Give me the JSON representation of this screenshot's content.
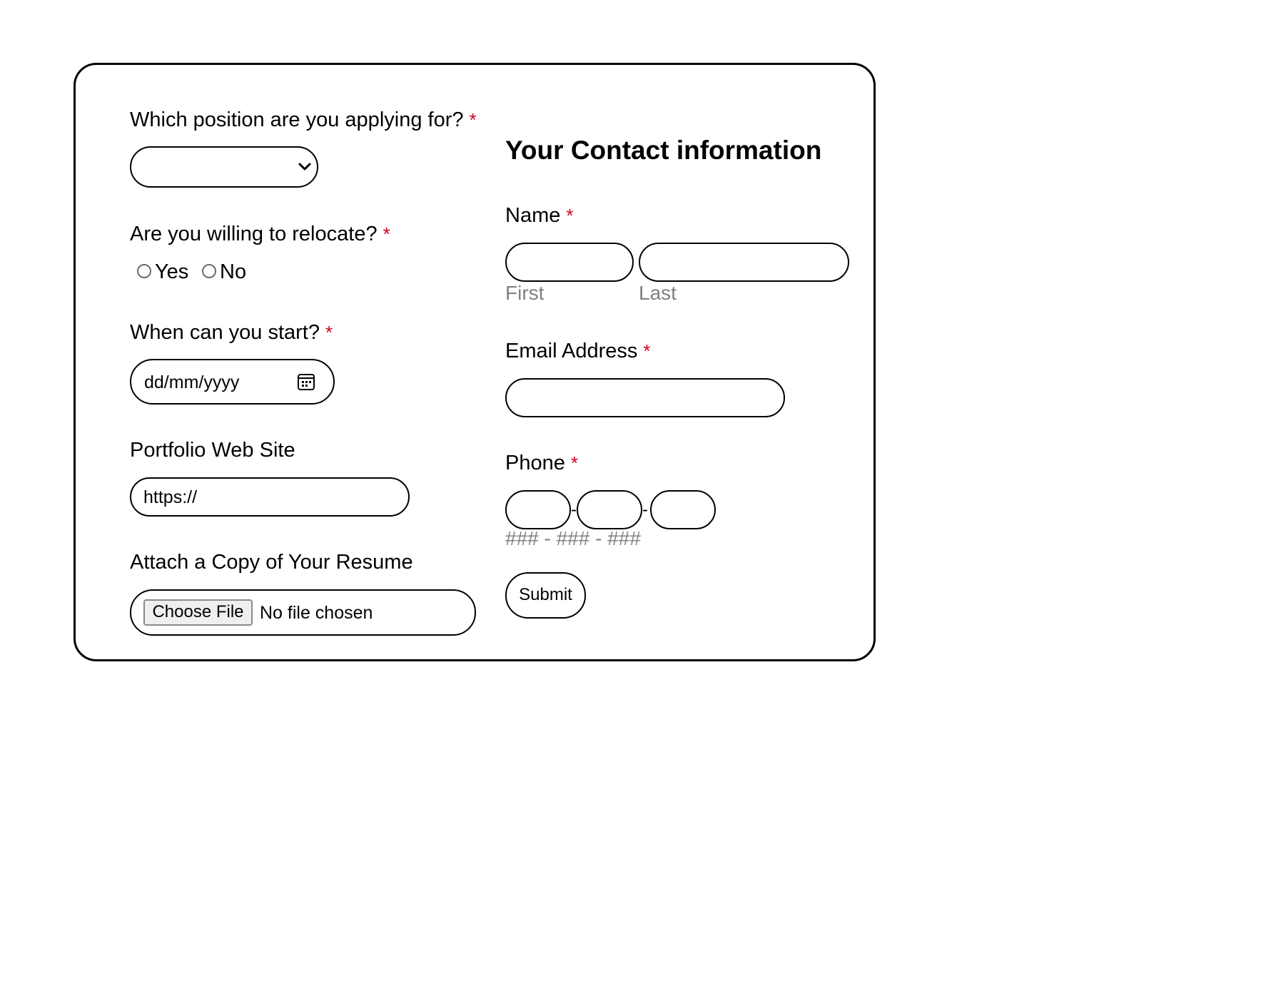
{
  "form": {
    "required_mark": "*",
    "position": {
      "label": "Which position are you applying for?",
      "selected_value": "",
      "icon": "chevron-down-icon"
    },
    "relocate": {
      "label": "Are you willing to relocate?",
      "options": [
        "Yes",
        "No"
      ]
    },
    "start_date": {
      "label": "When can you start?",
      "placeholder": "dd/mm/yyyy",
      "icon": "calendar-icon"
    },
    "portfolio": {
      "label": "Portfolio Web Site",
      "value": "https://"
    },
    "resume": {
      "label": "Attach a Copy of Your Resume",
      "button_label": "Choose File",
      "status_text": "No file chosen"
    },
    "contact": {
      "heading": "Your Contact information",
      "name": {
        "label": "Name",
        "first_sublabel": "First",
        "last_sublabel": "Last"
      },
      "email": {
        "label": "Email Address"
      },
      "phone": {
        "label": "Phone",
        "separator": "-",
        "format_hint": "### - ### - ###"
      }
    },
    "submit_label": "Submit"
  },
  "colors": {
    "required": "#d0021b",
    "sublabel": "#808080",
    "border": "#000000",
    "file_button_bg": "#efefef"
  }
}
